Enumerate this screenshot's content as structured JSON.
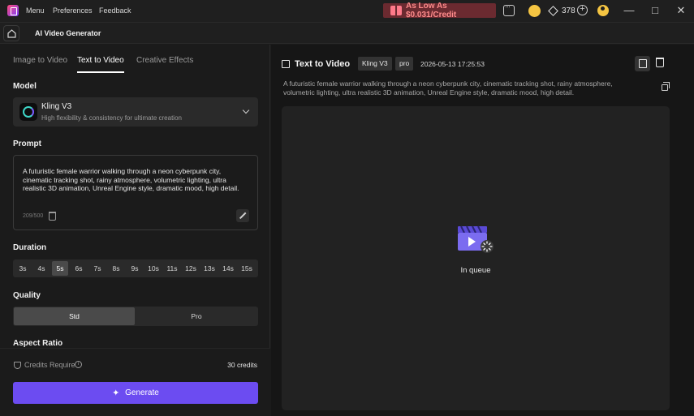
{
  "titlebar": {
    "menus": [
      "Menu",
      "Preferences",
      "Feedback"
    ],
    "promo": "As Low As $0.031/Credit",
    "credits": "378",
    "window_controls": [
      "minimize-icon",
      "maximize-icon",
      "close-icon"
    ]
  },
  "appbar": {
    "title": "AI Video Generator"
  },
  "left": {
    "tabs": [
      "Image to Video",
      "Text to Video",
      "Creative Effects"
    ],
    "active_tab": "Text to Video",
    "model_label": "Model",
    "model": {
      "name": "Kling V3",
      "desc": "High flexibility & consistency for ultimate creation"
    },
    "prompt_label": "Prompt",
    "prompt_text": "A futuristic female warrior walking through a neon cyberpunk city, cinematic tracking shot, rainy atmosphere, volumetric lighting, ultra realistic 3D animation, Unreal Engine style, dramatic mood, high detail.",
    "char_count": "209/500",
    "duration_label": "Duration",
    "durations": [
      "3s",
      "4s",
      "5s",
      "6s",
      "7s",
      "8s",
      "9s",
      "10s",
      "11s",
      "12s",
      "13s",
      "14s",
      "15s"
    ],
    "selected_duration": "5s",
    "quality_label": "Quality",
    "quality_options": [
      "Std",
      "Pro"
    ],
    "selected_quality": "Std",
    "aspect_label": "Aspect Ratio",
    "credits_label": "Credits Require",
    "credits_value": "30 credits",
    "generate_label": "Generate"
  },
  "right": {
    "title": "Text to Video",
    "model_badge": "Kling V3",
    "quality_badge": "pro",
    "timestamp": "2026-05-13 17:25:53",
    "prompt": "A futuristic female warrior walking through a neon cyberpunk city, cinematic tracking shot, rainy atmosphere, volumetric lighting, ultra realistic 3D animation, Unreal Engine style, dramatic mood, high detail.",
    "status": "In queue"
  },
  "colors": {
    "accent": "#6c4cf1",
    "promo_bg": "#6b2a30",
    "promo_text": "#ff8c8c",
    "coin": "#f5c542"
  }
}
